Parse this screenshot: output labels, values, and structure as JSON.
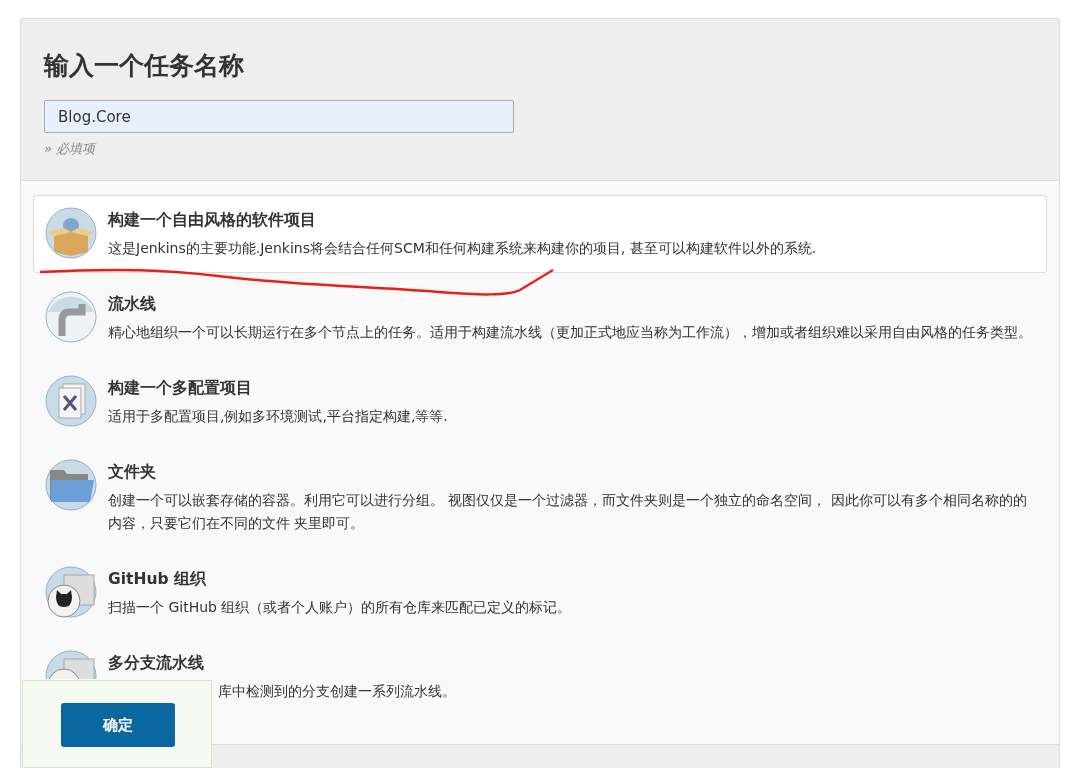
{
  "header": {
    "title": "输入一个任务名称",
    "name_field": {
      "value": "Blog.Core"
    },
    "hint": "» 必填项"
  },
  "items": [
    {
      "kind": "box",
      "title": "构建一个自由风格的软件项目",
      "description": "这是Jenkins的主要功能.Jenkins将会结合任何SCM和任何构建系统来构建你的项目, 甚至可以构建软件以外的系统.",
      "selected": true
    },
    {
      "kind": "pipe",
      "title": "流水线",
      "description": "精心地组织一个可以长期运行在多个节点上的任务。适用于构建流水线（更加正式地应当称为工作流），增加或者组织难以采用自由风格的任务类型。",
      "selected": false
    },
    {
      "kind": "multiconfig",
      "title": "构建一个多配置项目",
      "description": "适用于多配置项目,例如多环境测试,平台指定构建,等等.",
      "selected": false
    },
    {
      "kind": "folder",
      "title": "文件夹",
      "description": "创建一个可以嵌套存储的容器。利用它可以进行分组。 视图仅仅是一个过滤器，而文件夹则是一个独立的命名空间， 因此你可以有多个相同名称的的内容，只要它们在不同的文件 夹里即可。",
      "selected": false
    },
    {
      "kind": "github",
      "title": "GitHub 组织",
      "description": "扫描一个 GitHub 组织（或者个人账户）的所有仓库来匹配已定义的标记。",
      "selected": false
    },
    {
      "kind": "multibranch",
      "title": "多分支流水线",
      "description": "库中检测到的分支创建一系列流水线。",
      "covered": true,
      "selected": false
    }
  ],
  "footer": {
    "ok_button": "确定"
  }
}
